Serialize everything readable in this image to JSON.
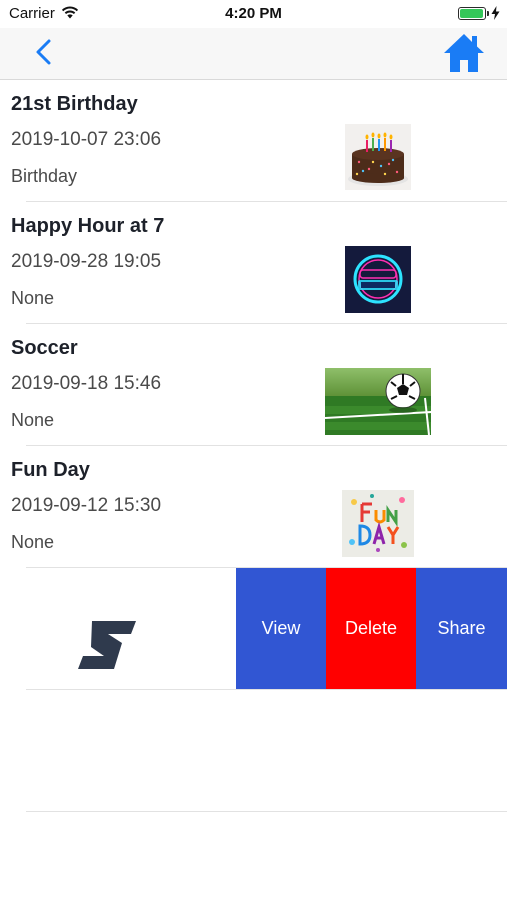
{
  "status_bar": {
    "carrier": "Carrier",
    "time": "4:20 PM"
  },
  "nav": {
    "back_icon": "chevron-left-icon",
    "home_icon": "home-icon",
    "accent": "#1a7cf5"
  },
  "events": [
    {
      "title": "21st Birthday",
      "date": "2019-10-07 23:06",
      "category": "Birthday",
      "image": "birthday-cake"
    },
    {
      "title": "Happy Hour at 7",
      "date": "2019-09-28 19:05",
      "category": "None",
      "image": "happy-hour-neon"
    },
    {
      "title": "Soccer",
      "date": "2019-09-18 15:46",
      "category": "None",
      "image": "soccer-ball-on-grass"
    },
    {
      "title": "Fun Day",
      "date": "2019-09-12 15:30",
      "category": "None",
      "image": "fun-day-card"
    }
  ],
  "swipe_actions": {
    "view": "View",
    "delete": "Delete",
    "share": "Share",
    "colors": {
      "view": "#3156d3",
      "delete": "#ff0000",
      "share": "#3156d3"
    }
  }
}
